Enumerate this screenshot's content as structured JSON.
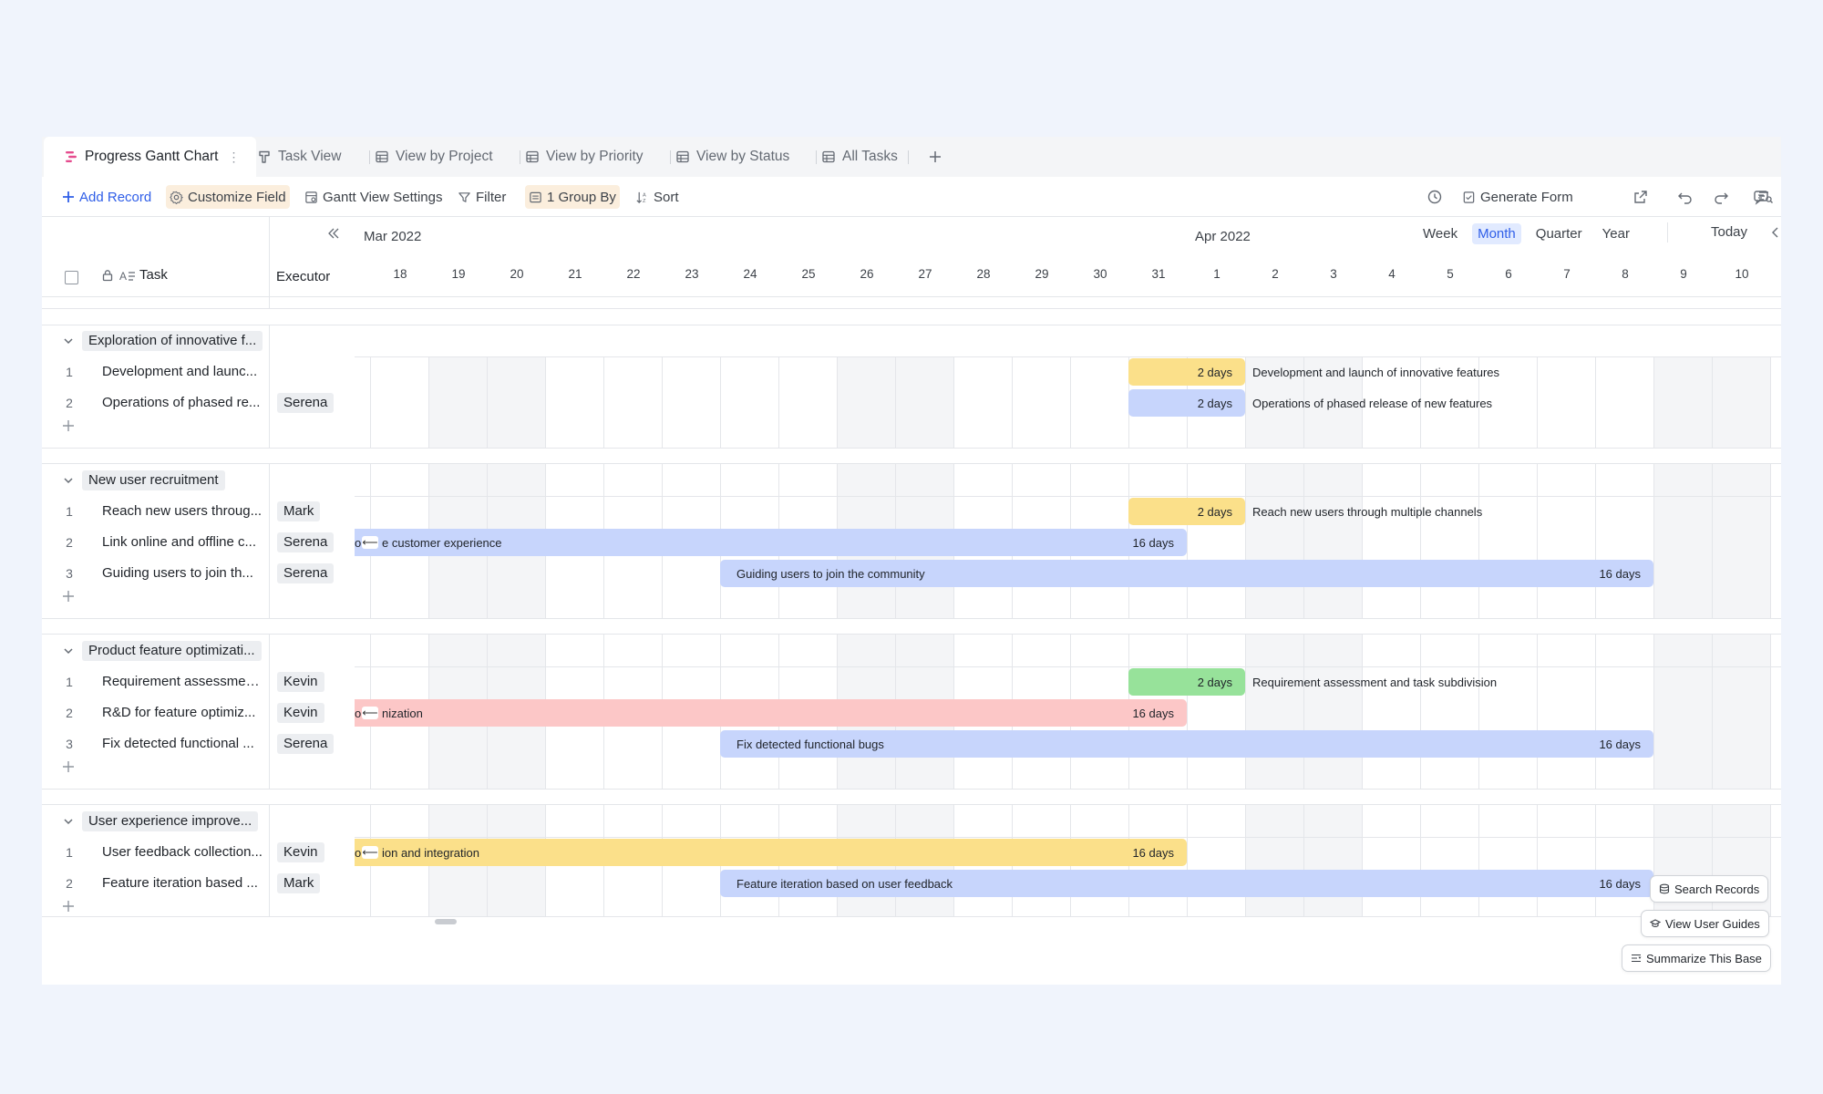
{
  "tabs": [
    {
      "label": "Progress Gantt Chart",
      "icon": "gantt-icon",
      "active": true
    },
    {
      "label": "Task View",
      "icon": "kanban-icon"
    },
    {
      "label": "View by Project",
      "icon": "grid-icon"
    },
    {
      "label": "View by Priority",
      "icon": "grid-icon"
    },
    {
      "label": "View by Status",
      "icon": "grid-icon"
    },
    {
      "label": "All Tasks",
      "icon": "grid-icon"
    }
  ],
  "toolbar": {
    "add_record": "Add Record",
    "customize_field": "Customize Field",
    "gantt_settings": "Gantt View Settings",
    "filter": "Filter",
    "group_by": "1 Group By",
    "sort": "Sort",
    "generate_form": "Generate Form"
  },
  "columns": {
    "task": "Task",
    "executor": "Executor"
  },
  "timeline": {
    "months": [
      "Mar 2022",
      "Apr 2022"
    ],
    "days": [
      "18",
      "19",
      "20",
      "21",
      "22",
      "23",
      "24",
      "25",
      "26",
      "27",
      "28",
      "29",
      "30",
      "31",
      "1",
      "2",
      "3",
      "4",
      "5",
      "6",
      "7",
      "8",
      "9",
      "10"
    ],
    "view_modes": [
      "Week",
      "Month",
      "Quarter",
      "Year"
    ],
    "active_view_mode": "Month",
    "today": "Today"
  },
  "groups": [
    {
      "name": "Exploration of innovative f...",
      "rows": [
        {
          "index": "1",
          "task": "Development and launc...",
          "executor": "",
          "bar_label": "Development and launch of innovative features",
          "duration": "2 days",
          "color": "#fbe08a"
        },
        {
          "index": "2",
          "task": "Operations of phased re...",
          "executor": "Serena",
          "bar_label": "Operations of phased release of new features",
          "duration": "2 days",
          "color": "#c7d5fc"
        }
      ]
    },
    {
      "name": "New user recruitment",
      "rows": [
        {
          "index": "1",
          "task": "Reach new users throug...",
          "executor": "Mark",
          "bar_label": "Reach new users through multiple channels",
          "duration": "2 days",
          "color": "#fbe08a"
        },
        {
          "index": "2",
          "task": "Link online and offline c...",
          "executor": "Serena",
          "bar_label": "e customer experience",
          "bar_prefix": "o",
          "duration": "16 days",
          "color": "#c7d5fc"
        },
        {
          "index": "3",
          "task": "Guiding users to join th...",
          "executor": "Serena",
          "bar_label": "Guiding users to join the community",
          "duration": "16 days",
          "color": "#c7d5fc"
        }
      ]
    },
    {
      "name": "Product feature optimizati...",
      "rows": [
        {
          "index": "1",
          "task": "Requirement assessmen...",
          "executor": "Kevin",
          "bar_label": "Requirement assessment and task subdivision",
          "duration": "2 days",
          "color": "#97e29a"
        },
        {
          "index": "2",
          "task": "R&D for feature optimiz...",
          "executor": "Kevin",
          "bar_label": "nization",
          "bar_prefix": "o",
          "duration": "16 days",
          "color": "#fcc7c7"
        },
        {
          "index": "3",
          "task": "Fix detected functional ...",
          "executor": "Serena",
          "bar_label": "Fix detected functional bugs",
          "duration": "16 days",
          "color": "#c7d5fc"
        }
      ]
    },
    {
      "name": "User experience improve...",
      "rows": [
        {
          "index": "1",
          "task": "User feedback collection...",
          "executor": "Kevin",
          "bar_label": "ion and integration",
          "bar_prefix": "o",
          "duration": "16 days",
          "color": "#fbe08a"
        },
        {
          "index": "2",
          "task": "Feature iteration based ...",
          "executor": "Mark",
          "bar_label": "Feature iteration based on user feedback",
          "duration": "16 days",
          "color": "#c7d5fc"
        }
      ]
    }
  ],
  "floating": {
    "search_records": "Search Records",
    "view_user_guides": "View User Guides",
    "summarize_base": "Summarize This Base"
  }
}
